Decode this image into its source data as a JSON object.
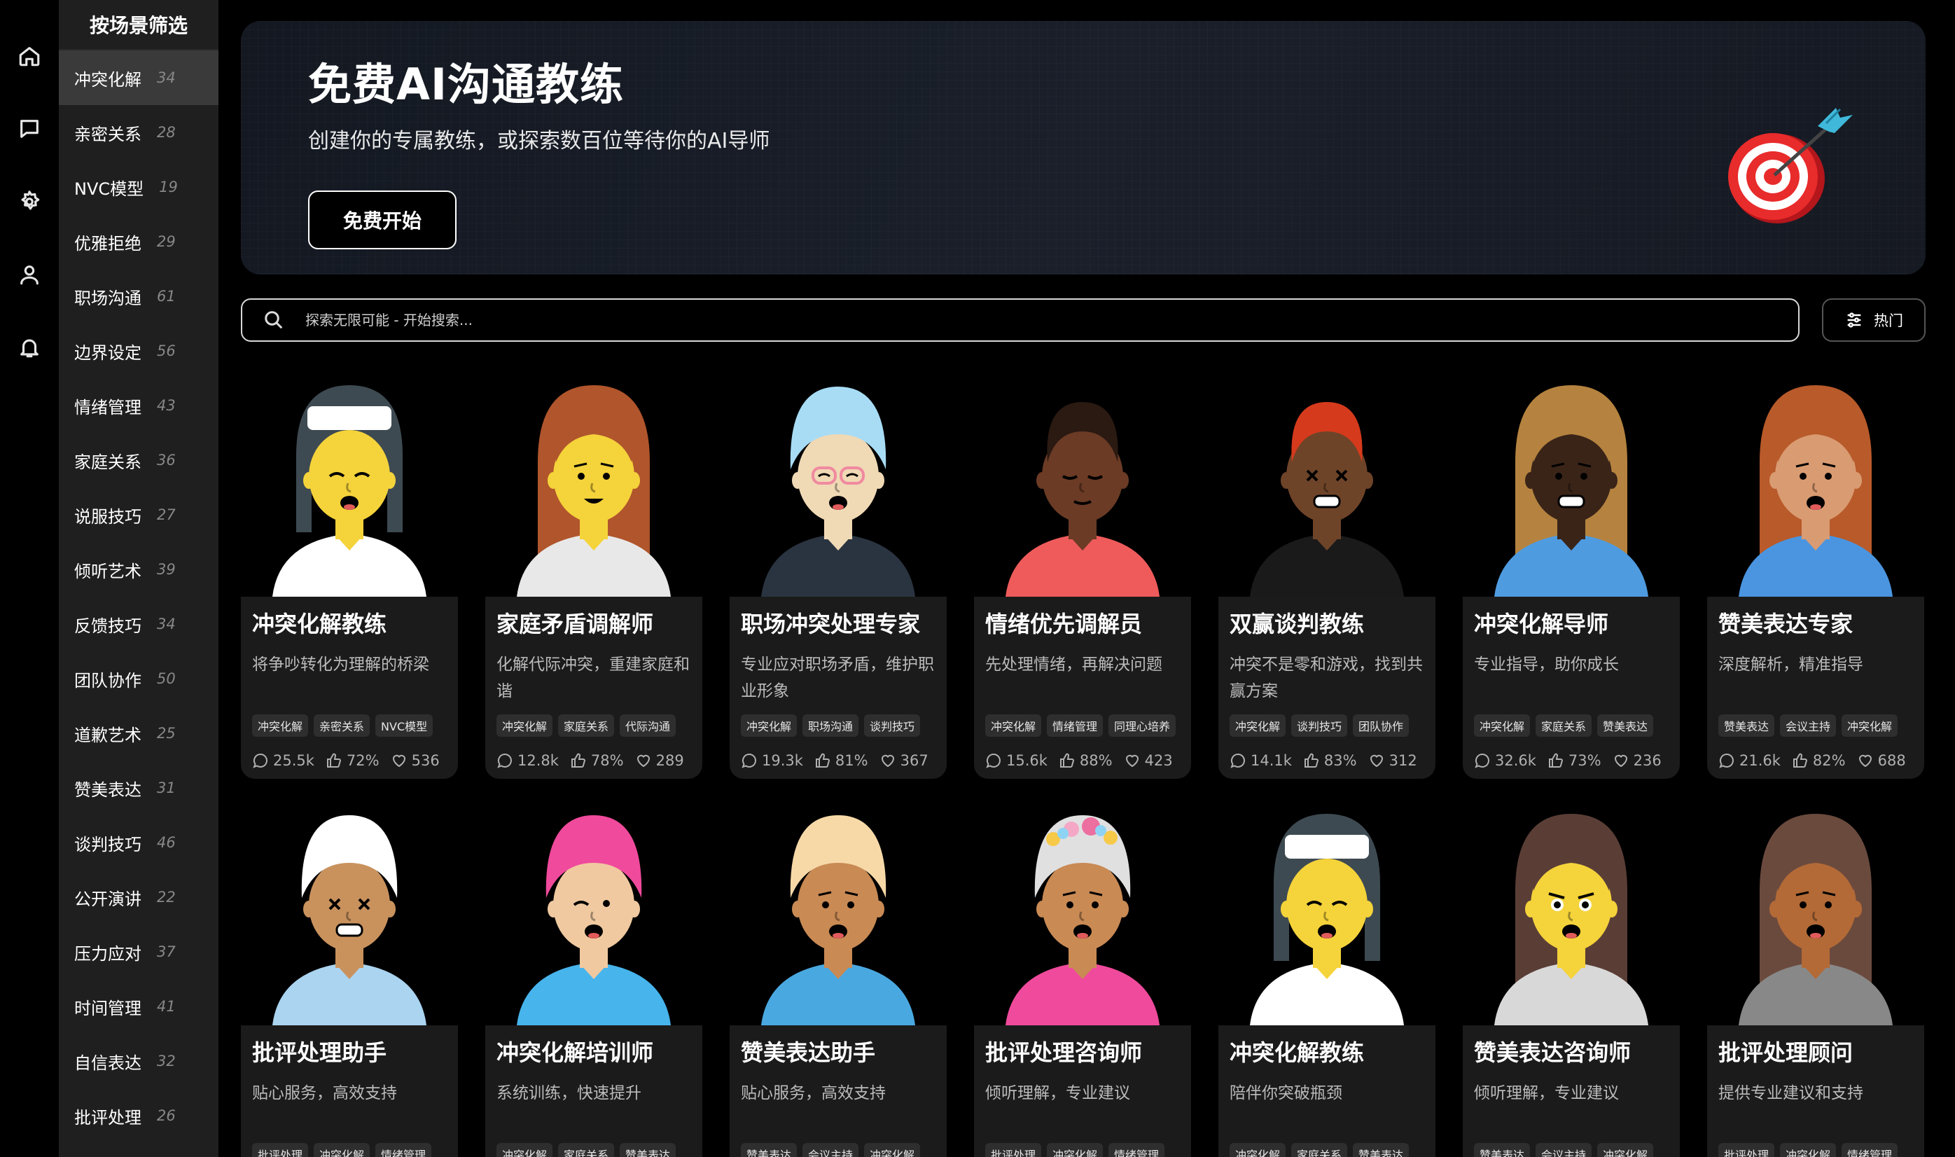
{
  "rail": {
    "icons": [
      "home-icon",
      "chat-icon",
      "settings-icon",
      "user-icon",
      "bell-icon"
    ]
  },
  "sidebar": {
    "title": "按场景筛选",
    "items": [
      {
        "label": "冲突化解",
        "count": "34"
      },
      {
        "label": "亲密关系",
        "count": "28"
      },
      {
        "label": "NVC模型",
        "count": "19"
      },
      {
        "label": "优雅拒绝",
        "count": "29"
      },
      {
        "label": "职场沟通",
        "count": "61"
      },
      {
        "label": "边界设定",
        "count": "56"
      },
      {
        "label": "情绪管理",
        "count": "43"
      },
      {
        "label": "家庭关系",
        "count": "36"
      },
      {
        "label": "说服技巧",
        "count": "27"
      },
      {
        "label": "倾听艺术",
        "count": "39"
      },
      {
        "label": "反馈技巧",
        "count": "34"
      },
      {
        "label": "团队协作",
        "count": "50"
      },
      {
        "label": "道歉艺术",
        "count": "25"
      },
      {
        "label": "赞美表达",
        "count": "31"
      },
      {
        "label": "谈判技巧",
        "count": "46"
      },
      {
        "label": "公开演讲",
        "count": "22"
      },
      {
        "label": "压力应对",
        "count": "37"
      },
      {
        "label": "时间管理",
        "count": "41"
      },
      {
        "label": "自信表达",
        "count": "32"
      },
      {
        "label": "批评处理",
        "count": "26"
      }
    ]
  },
  "hero": {
    "title": "免费AI沟通教练",
    "subtitle": "创建你的专属教练，或探索数百位等待你的AI导师",
    "cta": "免费开始"
  },
  "search": {
    "placeholder": "探索无限可能 - 开始搜索...",
    "filter_label": "热门"
  },
  "cards": [
    {
      "name": "冲突化解教练",
      "desc": "将争吵转化为理解的桥梁",
      "tags": [
        "冲突化解",
        "亲密关系",
        "NVC模型"
      ],
      "comments": "25.5k",
      "likes": "72%",
      "hearts": "536"
    },
    {
      "name": "家庭矛盾调解师",
      "desc": "化解代际冲突，重建家庭和谐",
      "tags": [
        "冲突化解",
        "家庭关系",
        "代际沟通"
      ],
      "comments": "12.8k",
      "likes": "78%",
      "hearts": "289"
    },
    {
      "name": "职场冲突处理专家",
      "desc": "专业应对职场矛盾，维护职业形象",
      "tags": [
        "冲突化解",
        "职场沟通",
        "谈判技巧"
      ],
      "comments": "19.3k",
      "likes": "81%",
      "hearts": "367"
    },
    {
      "name": "情绪优先调解员",
      "desc": "先处理情绪，再解决问题",
      "tags": [
        "冲突化解",
        "情绪管理",
        "同理心培养"
      ],
      "comments": "15.6k",
      "likes": "88%",
      "hearts": "423"
    },
    {
      "name": "双赢谈判教练",
      "desc": "冲突不是零和游戏，找到共赢方案",
      "tags": [
        "冲突化解",
        "谈判技巧",
        "团队协作"
      ],
      "comments": "14.1k",
      "likes": "83%",
      "hearts": "312"
    },
    {
      "name": "冲突化解导师",
      "desc": "专业指导，助你成长",
      "tags": [
        "冲突化解",
        "家庭关系",
        "赞美表达"
      ],
      "comments": "32.6k",
      "likes": "73%",
      "hearts": "236"
    },
    {
      "name": "赞美表达专家",
      "desc": "深度解析，精准指导",
      "tags": [
        "赞美表达",
        "会议主持",
        "冲突化解"
      ],
      "comments": "21.6k",
      "likes": "82%",
      "hearts": "688"
    },
    {
      "name": "批评处理助手",
      "desc": "贴心服务，高效支持",
      "tags": [
        "批评处理",
        "冲突化解",
        "情绪管理"
      ]
    },
    {
      "name": "冲突化解培训师",
      "desc": "系统训练，快速提升",
      "tags": [
        "冲突化解",
        "家庭关系",
        "赞美表达"
      ]
    },
    {
      "name": "赞美表达助手",
      "desc": "贴心服务，高效支持",
      "tags": [
        "赞美表达",
        "会议主持",
        "冲突化解"
      ]
    },
    {
      "name": "批评处理咨询师",
      "desc": "倾听理解，专业建议",
      "tags": [
        "批评处理",
        "冲突化解",
        "情绪管理"
      ]
    },
    {
      "name": "冲突化解教练",
      "desc": "陪伴你突破瓶颈",
      "tags": [
        "冲突化解",
        "家庭关系",
        "赞美表达"
      ]
    },
    {
      "name": "赞美表达咨询师",
      "desc": "倾听理解，专业建议",
      "tags": [
        "赞美表达",
        "会议主持",
        "冲突化解"
      ]
    },
    {
      "name": "批评处理顾问",
      "desc": "提供专业建议和支持",
      "tags": [
        "批评处理",
        "冲突化解",
        "情绪管理"
      ]
    }
  ],
  "avatars": [
    {
      "skin": "#f5d33a",
      "hair": "#3e4a52",
      "shirt": "#ffffff",
      "hat": "#ffffff",
      "style": "beanie",
      "face": "squint"
    },
    {
      "skin": "#f5d33a",
      "hair": "#b0552c",
      "shirt": "#e8e8e8",
      "hat": "",
      "style": "long",
      "face": "smile"
    },
    {
      "skin": "#f0d9b5",
      "hair": "#a8dcf5",
      "shirt": "#2a3440",
      "hat": "",
      "style": "bun",
      "face": "glasses"
    },
    {
      "skin": "#6b3b25",
      "hair": "#2b1a12",
      "shirt": "#ef5b5b",
      "hat": "",
      "style": "short",
      "face": "calm"
    },
    {
      "skin": "#6e4429",
      "hair": "#d63a1c",
      "shirt": "#1a1a1a",
      "hat": "",
      "style": "short",
      "face": "x"
    },
    {
      "skin": "#3a2418",
      "hair": "#b5833f",
      "shirt": "#4f9be0",
      "hat": "",
      "style": "long",
      "face": "grit"
    },
    {
      "skin": "#d99b72",
      "hair": "#b85a2a",
      "shirt": "#4b95e0",
      "hat": "",
      "style": "curly",
      "face": "worried"
    },
    {
      "skin": "#c9925d",
      "hair": "#ffffff",
      "shirt": "#aad4f0",
      "hat": "",
      "style": "bun",
      "face": "x"
    },
    {
      "skin": "#f0c9a0",
      "hair": "#f04a9c",
      "shirt": "#47b4ec",
      "hat": "",
      "style": "bun",
      "face": "wink"
    },
    {
      "skin": "#c98a54",
      "hair": "#f7d9a8",
      "shirt": "#4aa8e0",
      "hat": "",
      "style": "bun",
      "face": "sad"
    },
    {
      "skin": "#c98a54",
      "hair": "#e0e0e0",
      "shirt": "#f04a9c",
      "hat": "",
      "style": "flower",
      "face": "shock"
    },
    {
      "skin": "#f5d33a",
      "hair": "#3e4a52",
      "shirt": "#ffffff",
      "hat": "#ffffff",
      "style": "beanie",
      "face": "squint"
    },
    {
      "skin": "#f5d33a",
      "hair": "#5a3e36",
      "shirt": "#d8d8d8",
      "hat": "",
      "style": "long",
      "face": "angry"
    },
    {
      "skin": "#b36a36",
      "hair": "#6b4a3e",
      "shirt": "#888888",
      "hat": "",
      "style": "long",
      "face": "sad"
    }
  ]
}
